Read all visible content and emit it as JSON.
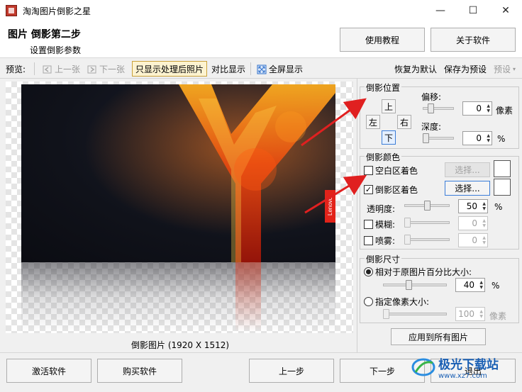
{
  "window": {
    "title": "淘淘图片倒影之星",
    "minimize": "—",
    "maximize": "☐",
    "close": "✕"
  },
  "header": {
    "step_title": "图片 倒影第二步",
    "step_subtitle": "设置倒影参数",
    "tutorial_button": "使用教程",
    "about_button": "关于软件"
  },
  "toolbar": {
    "preview_label": "预览:",
    "prev_image": "上一张",
    "next_image": "下一张",
    "show_processed": "只显示处理后照片",
    "compare": "对比显示",
    "fullscreen": "全屏显示",
    "restore_default": "恢复为默认",
    "save_preset": "保存为预设",
    "preset": "预设"
  },
  "preview": {
    "caption": "倒影图片 (1920 X 1512)",
    "brand_tag": "Lenovo"
  },
  "reflection_position": {
    "title": "倒影位置",
    "up": "上",
    "left": "左",
    "right": "右",
    "down": "下",
    "offset_label": "偏移:",
    "offset_value": "0",
    "offset_unit": "像素",
    "offset_slider": 0.2,
    "depth_label": "深度:",
    "depth_value": "0",
    "depth_unit": "%",
    "depth_slider": 0.0
  },
  "reflection_color": {
    "title": "倒影颜色",
    "blank_area_label": "空白区着色",
    "blank_area_checked": false,
    "blank_area_select": "选择...",
    "reflection_area_label": "倒影区着色",
    "reflection_area_checked": true,
    "reflection_area_select": "选择...",
    "opacity_label": "透明度:",
    "opacity_value": "50",
    "opacity_unit": "%",
    "opacity_slider": 0.5,
    "blur_label": "模糊:",
    "blur_value": "0",
    "blur_checked": false,
    "spray_label": "喷雾:",
    "spray_value": "0",
    "spray_checked": false
  },
  "reflection_size": {
    "title": "倒影尺寸",
    "relative_label": "相对于原图片百分比大小:",
    "relative_selected": true,
    "relative_value": "40",
    "relative_unit": "%",
    "relative_slider": 0.4,
    "pixel_label": "指定像素大小:",
    "pixel_selected": false,
    "pixel_value": "100",
    "pixel_unit": "像素",
    "pixel_slider": 0.0,
    "apply_all": "应用到所有图片"
  },
  "footer": {
    "activate": "激活软件",
    "buy": "购买软件",
    "prev_step": "上一步",
    "next_step": "下一步",
    "exit": "退出"
  },
  "watermark": {
    "text": "极光下载站",
    "sub": "www.xz7.com"
  },
  "colors": {
    "accent": "#3b7dd8",
    "arrow": "#e02020",
    "brand_red": "#e2231a"
  }
}
